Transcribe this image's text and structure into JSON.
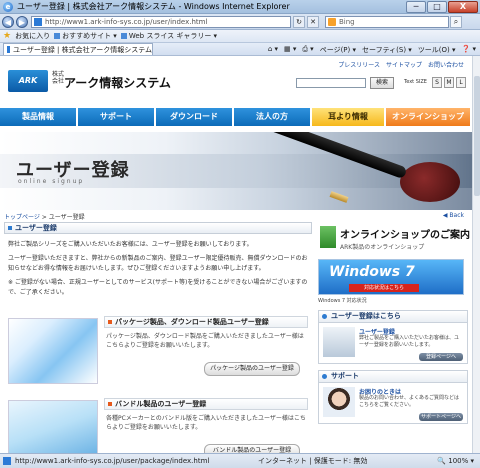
{
  "window": {
    "title": "ユーザー登録 | 株式会社アーク情報システム - Windows Internet Explorer",
    "buttons": {
      "minimize": "─",
      "maximize": "□",
      "close": "X"
    }
  },
  "address": {
    "url": "http://www1.ark-info-sys.co.jp/user/index.html",
    "search_placeholder": "Bing"
  },
  "favorites": {
    "label": "お気に入り",
    "items": [
      "おすすめサイト ▾",
      "Web スライス ギャラリー ▾"
    ]
  },
  "tab": {
    "label": "ユーザー登録 | 株式会社アーク情報システム",
    "commands": [
      "ページ(P) ▾",
      "セーフティ(S) ▾",
      "ツール(O) ▾",
      "❓ ▾"
    ]
  },
  "site": {
    "logo_mark": "ARK",
    "logo_small": "株式\n会社",
    "logo_name": "アーク情報システム",
    "top_links": [
      "プレスリリース",
      "サイトマップ",
      "お問い合わせ"
    ],
    "search_button": "検索",
    "text_size_label": "Text SIZE",
    "sizes": [
      "S",
      "M",
      "L"
    ],
    "nav": [
      "製品情報",
      "サポート",
      "ダウンロード",
      "法人の方",
      "耳より情報",
      "オンラインショップ"
    ]
  },
  "banner": {
    "title": "ユーザー登録",
    "subtitle": "online signup"
  },
  "breadcrumb": {
    "home": "トップページ",
    "separator": " > ",
    "current": "ユーザー登録",
    "back": "Back"
  },
  "main": {
    "section_title": "ユーザー登録",
    "intro": [
      "弊社ご製品シリーズをご購入いただいたお客様には、ユーザー登録をお願いしております。",
      "ユーザー登録いただきますと、弊社からの新製品のご案内、登録ユーザー限定優待販売、無償ダウンロードのお知らせなどお得な情報をお届けいたします。ぜひご登録くださいますようお願い申し上げます。",
      "※ ご登録がない場合、正規ユーザーとしてのサービス(サポート等)を受けることができない場合がございますので、ご了承ください。"
    ],
    "cards": [
      {
        "title": "パッケージ製品、ダウンロード製品ユーザー登録",
        "desc": "パッケージ製品、ダウンロード製品をご購入いただきましたユーザー様はこちらよりご登録をお願いいたします。",
        "button": "パッケージ製品のユーザー登録"
      },
      {
        "title": "バンドル製品のユーザー登録",
        "desc": "各種PCメーカーとのバンドル版をご購入いただきましたユーザー様はこちらよりご登録をお願いいたします。",
        "button": "バンドル製品のユーザー登録"
      }
    ]
  },
  "side": {
    "shop_title": "オンラインショップのご案内",
    "shop_sub": "ARK製品のオンラインショップ",
    "win7_text": "Windows 7",
    "win7_tag": "対応状況はこちら",
    "win7_caption": "Windows 7 対応状況",
    "boxes": [
      {
        "header": "ユーザー登録はこちら",
        "title": "ユーザー登録",
        "desc": "弊社ご製品をご購入いただいたお客様は、ユーザー登録をお願いいたします。",
        "button": "登録ページへ"
      },
      {
        "header": "サポート",
        "title": "お困りのときは",
        "desc": "製品のお問い合わせ、よくあるご質問などはこちらをご覧ください。",
        "button": "サポートページへ"
      }
    ]
  },
  "status": {
    "url": "http://www1.ark-info-sys.co.jp/user/package/index.html",
    "zone": "インターネット | 保護モード: 無効",
    "zoom": "100%"
  }
}
